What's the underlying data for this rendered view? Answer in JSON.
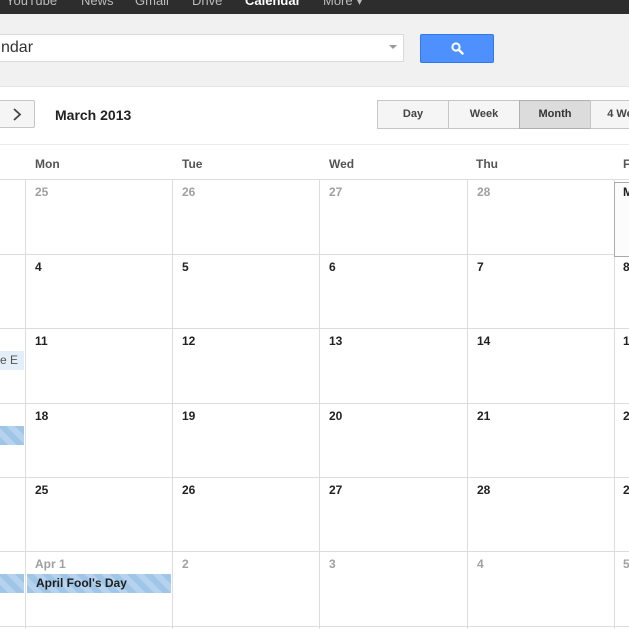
{
  "topnav": {
    "items": [
      {
        "label": "YouTube",
        "active": false
      },
      {
        "label": "News",
        "active": false
      },
      {
        "label": "Gmail",
        "active": false
      },
      {
        "label": "Drive",
        "active": false
      },
      {
        "label": "Calendar",
        "active": true
      },
      {
        "label": "More ▾",
        "active": false
      }
    ]
  },
  "search": {
    "value": "ndar",
    "button_icon": "search-icon"
  },
  "toolbar": {
    "next_icon": "chevron-right-icon",
    "date_title": "March 2013",
    "views": [
      {
        "label": "Day",
        "selected": false
      },
      {
        "label": "Week",
        "selected": false
      },
      {
        "label": "Month",
        "selected": true
      },
      {
        "label": "4 We",
        "selected": false
      }
    ]
  },
  "calendar": {
    "day_headers": [
      "Mon",
      "Tue",
      "Wed",
      "Thu",
      "F"
    ],
    "weeks": [
      [
        "25",
        "26",
        "27",
        "28",
        "M"
      ],
      [
        "4",
        "5",
        "6",
        "7",
        "8"
      ],
      [
        "11",
        "12",
        "13",
        "14",
        "1"
      ],
      [
        "18",
        "19",
        "20",
        "21",
        "2"
      ],
      [
        "25",
        "26",
        "27",
        "28",
        "2"
      ],
      [
        "Apr 1",
        "2",
        "3",
        "4",
        "5"
      ]
    ],
    "events": [
      {
        "label": "e E"
      },
      {
        "label": ""
      },
      {
        "label": ""
      },
      {
        "label": "April Fool's Day"
      }
    ]
  },
  "colors": {
    "accent_blue": "#4d90fe",
    "event_blue": "#9fc6e7",
    "topbar": "#2d2d2d"
  }
}
